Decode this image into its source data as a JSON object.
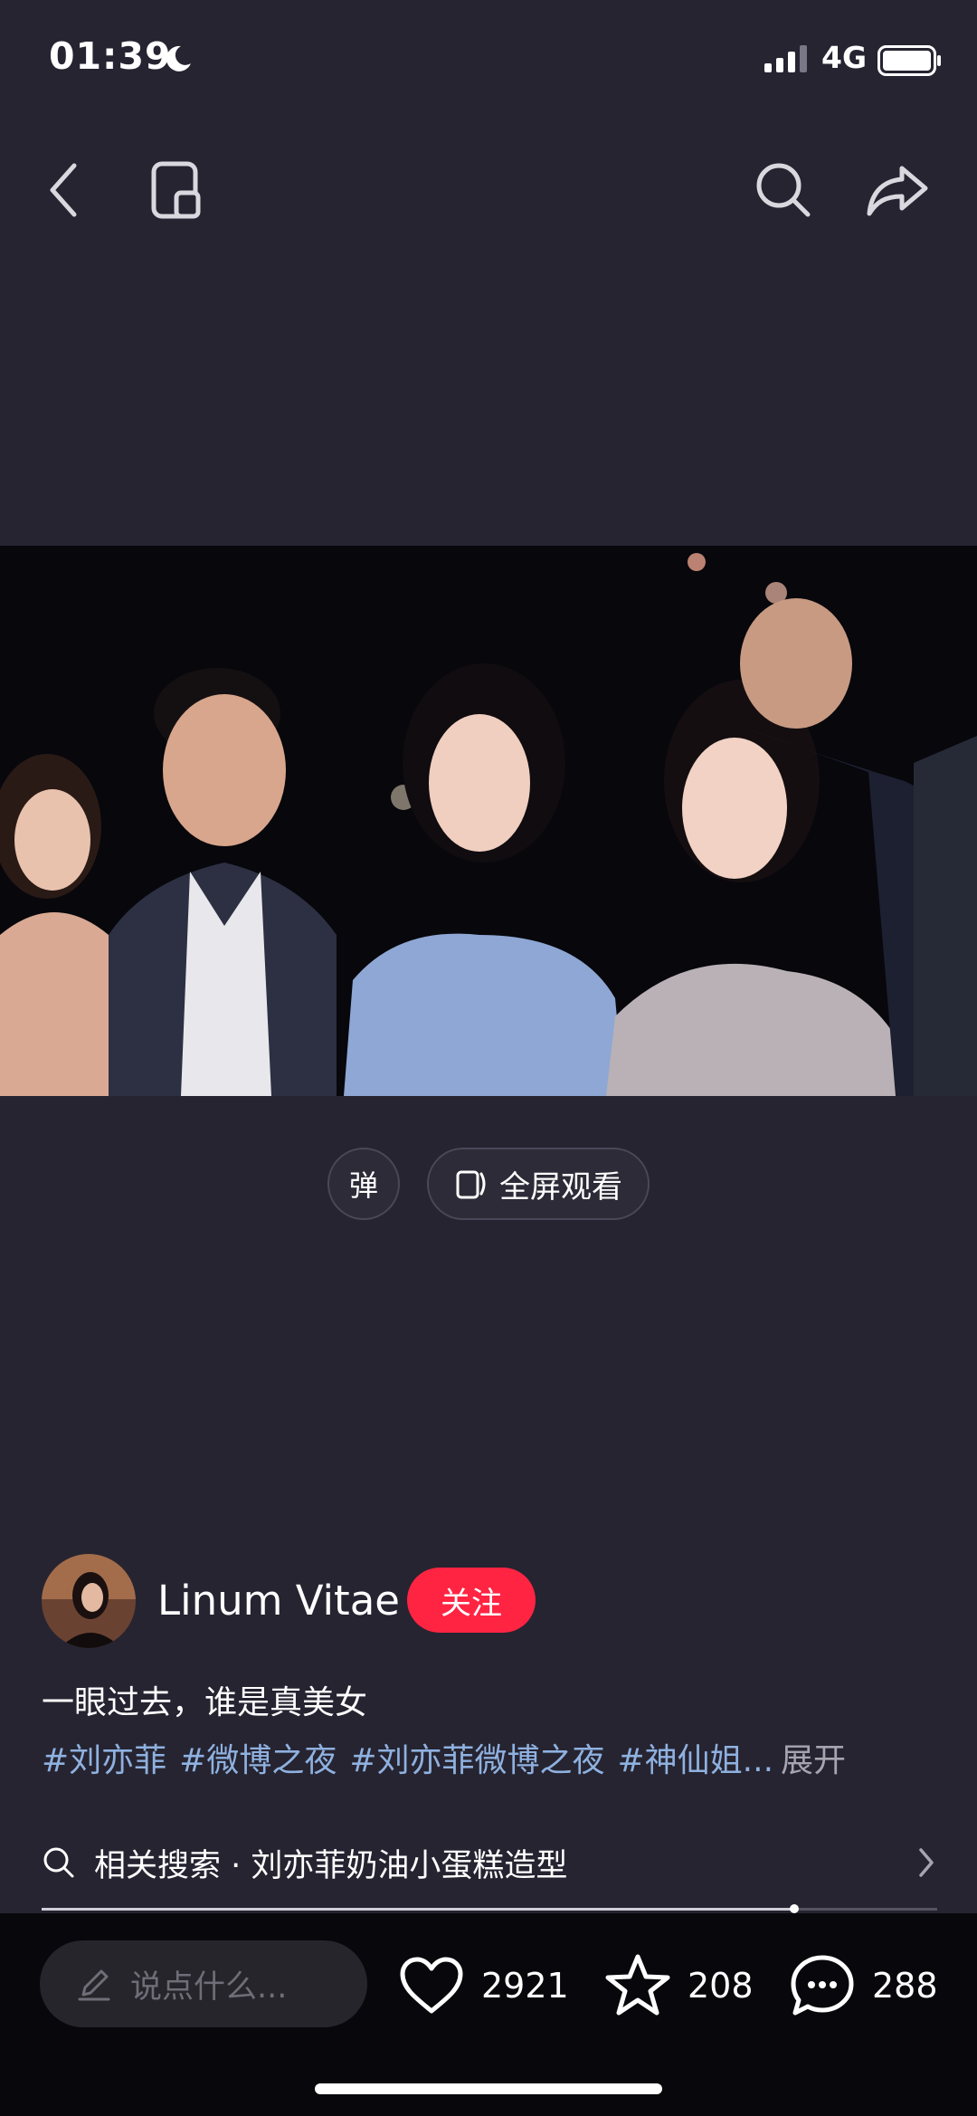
{
  "status_bar": {
    "time": "01:39",
    "network": "4G",
    "icons": [
      "moon-icon",
      "signal-icon",
      "battery-icon"
    ]
  },
  "nav": {
    "icons": [
      "back-icon",
      "window-icon",
      "search-icon",
      "share-icon"
    ]
  },
  "video_controls": {
    "danmaku_label": "弹",
    "fullscreen_label": "全屏观看"
  },
  "author": {
    "name": "Linum Vitae",
    "follow_label": "关注"
  },
  "post": {
    "caption": "一眼过去，谁是真美女",
    "tags": [
      "#刘亦菲",
      "#微博之夜",
      "#刘亦菲微博之夜"
    ],
    "tag_truncated": "#神仙姐...",
    "expand_label": "展开"
  },
  "related_search": {
    "label": "相关搜索 · 刘亦菲奶油小蛋糕造型"
  },
  "progress": {
    "value_fraction": 0.84
  },
  "bottom_bar": {
    "comment_placeholder": "说点什么...",
    "likes": "2921",
    "favorites": "208",
    "comments": "288"
  },
  "colors": {
    "background": "#262431",
    "follow_button": "#ff2442",
    "hashtag": "#8fb1e0",
    "bottom_bar": "#08080c"
  }
}
